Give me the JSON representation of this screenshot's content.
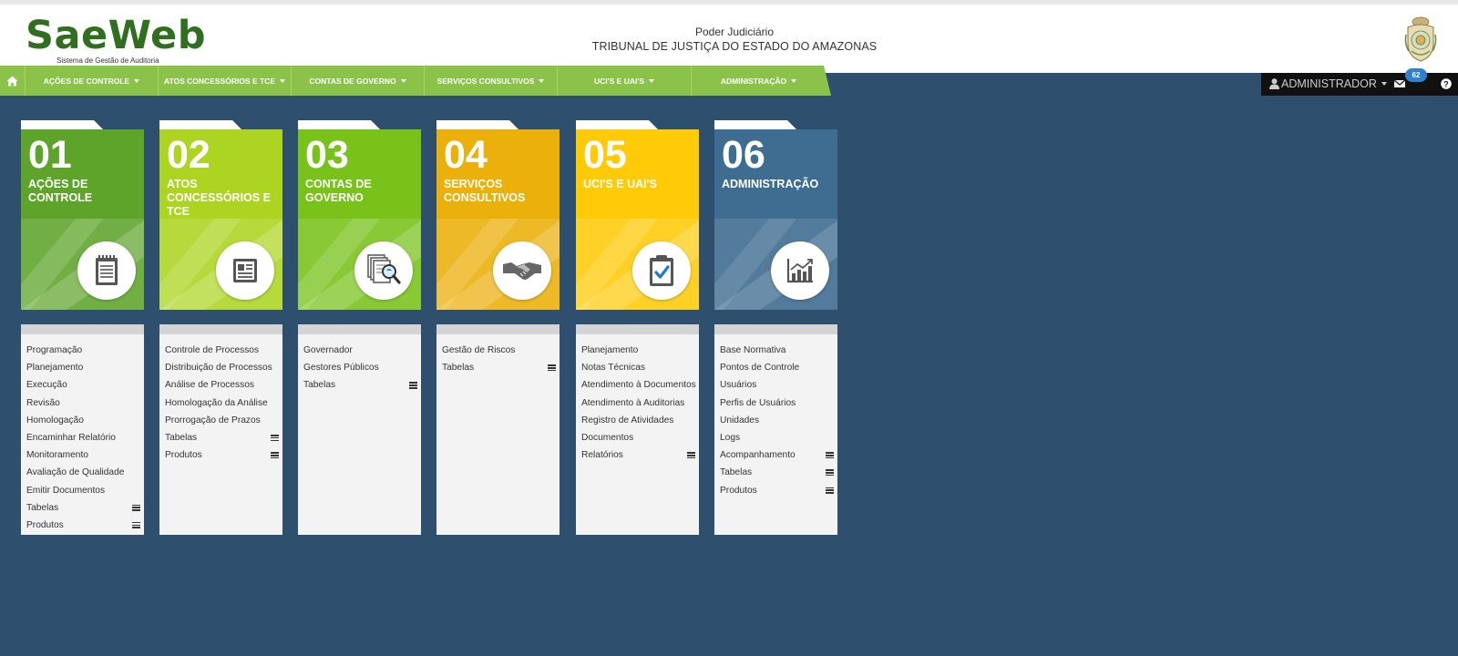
{
  "header": {
    "logo_text": "SaeWeb",
    "logo_subtitle": "Sistema de Gestão de Auditoria",
    "org_line1": "Poder Judiciário",
    "org_line2": "TRIBUNAL DE JUSTIÇA DO ESTADO DO AMAZONAS"
  },
  "nav": {
    "home_icon": "home-icon",
    "items": [
      {
        "label": "AÇÕES DE CONTROLE"
      },
      {
        "label": "ATOS CONCESSÓRIOS E TCE"
      },
      {
        "label": "CONTAS DE GOVERNO"
      },
      {
        "label": "SERVIÇOS CONSULTIVOS"
      },
      {
        "label": "UCI'S E UAI'S"
      },
      {
        "label": "ADMINISTRAÇÃO"
      }
    ]
  },
  "userbar": {
    "user_label": "ADMINISTRADOR",
    "mail_count": "62"
  },
  "colors": {
    "background": "#2f4f6f",
    "nav_green": "#8bc34a",
    "card1": "#5ea42b",
    "card2": "#acd420",
    "card3": "#78c21a",
    "card4": "#ecb00a",
    "card5": "#ffcb08",
    "card6": "#3f6c91"
  },
  "modules": [
    {
      "number": "01",
      "title": "AÇÕES DE CONTROLE",
      "icon": "notepad-icon",
      "items": [
        {
          "label": "Programação"
        },
        {
          "label": "Planejamento"
        },
        {
          "label": "Execução"
        },
        {
          "label": "Revisão"
        },
        {
          "label": "Homologação"
        },
        {
          "label": "Encaminhar Relatório"
        },
        {
          "label": "Monitoramento"
        },
        {
          "label": "Avaliação de Qualidade"
        },
        {
          "label": "Emitir Documentos"
        },
        {
          "label": "Tabelas",
          "submenu": true
        },
        {
          "label": "Produtos",
          "submenu": true
        }
      ]
    },
    {
      "number": "02",
      "title": "ATOS CONCESSÓRIOS E TCE",
      "icon": "id-card-icon",
      "items": [
        {
          "label": "Controle de Processos"
        },
        {
          "label": "Distribuição de Processos"
        },
        {
          "label": "Análise de Processos"
        },
        {
          "label": "Homologação da Análise"
        },
        {
          "label": "Prorrogação de Prazos"
        },
        {
          "label": "Tabelas",
          "submenu": true
        },
        {
          "label": "Produtos",
          "submenu": true
        }
      ]
    },
    {
      "number": "03",
      "title": "CONTAS DE GOVERNO",
      "icon": "document-search-icon",
      "items": [
        {
          "label": "Governador"
        },
        {
          "label": "Gestores Públicos"
        },
        {
          "label": "Tabelas",
          "submenu": true
        }
      ]
    },
    {
      "number": "04",
      "title": "SERVIÇOS CONSULTIVOS",
      "icon": "handshake-icon",
      "items": [
        {
          "label": "Gestão de Riscos"
        },
        {
          "label": "Tabelas",
          "submenu": true
        }
      ]
    },
    {
      "number": "05",
      "title": "UCI'S E UAI'S",
      "icon": "clipboard-check-icon",
      "items": [
        {
          "label": "Planejamento"
        },
        {
          "label": "Notas Técnicas"
        },
        {
          "label": "Atendimento à Documentos"
        },
        {
          "label": "Atendimento à Auditorias"
        },
        {
          "label": "Registro de Atividades"
        },
        {
          "label": "Documentos"
        },
        {
          "label": "Relatórios",
          "submenu": true
        }
      ]
    },
    {
      "number": "06",
      "title": "ADMINISTRAÇÃO",
      "icon": "chart-growth-icon",
      "items": [
        {
          "label": "Base Normativa"
        },
        {
          "label": "Pontos de Controle"
        },
        {
          "label": "Usuários"
        },
        {
          "label": "Perfis de Usuários"
        },
        {
          "label": "Unidades"
        },
        {
          "label": "Logs"
        },
        {
          "label": "Acompanhamento",
          "submenu": true
        },
        {
          "label": "Tabelas",
          "submenu": true
        },
        {
          "label": "Produtos",
          "submenu": true
        }
      ]
    }
  ]
}
